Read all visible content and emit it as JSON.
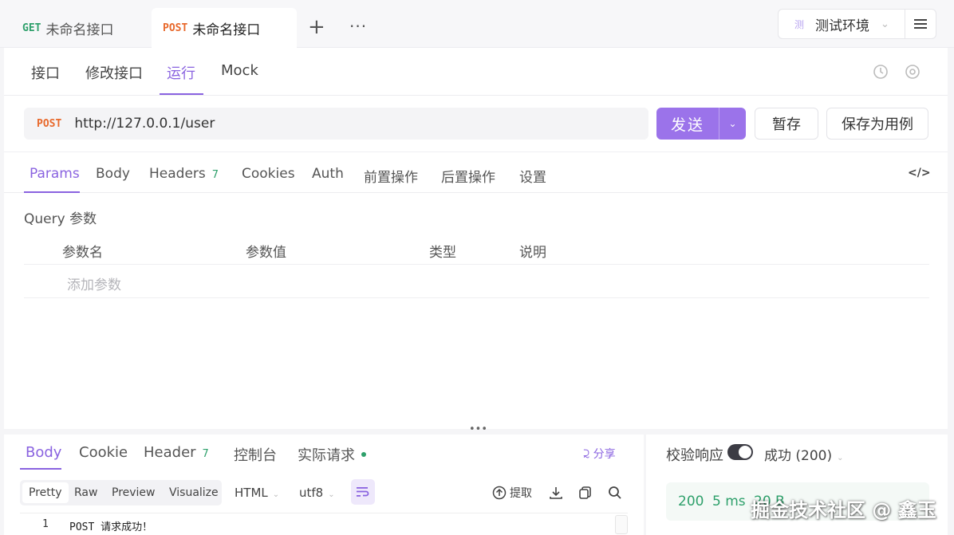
{
  "tabs": [
    {
      "method": "GET",
      "label": "未命名接口"
    },
    {
      "method": "POST",
      "label": "未命名接口"
    }
  ],
  "toolbar": {
    "plus": "+",
    "more": "···"
  },
  "environment": {
    "icon_char": "测",
    "label": "测试环境"
  },
  "subnav": [
    "接口",
    "修改接口",
    "运行",
    "Mock"
  ],
  "request": {
    "method": "POST",
    "url": "http://127.0.0.1/user",
    "send_label": "发送",
    "save_label": "暂存",
    "save_case_label": "保存为用例"
  },
  "param_tabs": {
    "params": "Params",
    "body": "Body",
    "headers": "Headers",
    "headers_count": "7",
    "cookies": "Cookies",
    "auth": "Auth",
    "pre": "前置操作",
    "post": "后置操作",
    "settings": "设置"
  },
  "query": {
    "title": "Query 参数",
    "columns": [
      "参数名",
      "参数值",
      "类型",
      "说明"
    ],
    "add_placeholder": "添加参数"
  },
  "response": {
    "tabs": {
      "body": "Body",
      "cookie": "Cookie",
      "header": "Header",
      "header_count": "7",
      "console": "控制台",
      "actual": "实际请求"
    },
    "share": "分享",
    "formats": [
      "Pretty",
      "Raw",
      "Preview",
      "Visualize"
    ],
    "content_type": "HTML",
    "encoding": "utf8",
    "extract": "提取",
    "line_number": "1",
    "code": "POST 请求成功！"
  },
  "validation": {
    "label": "校验响应",
    "enabled": true,
    "status": "成功 (200)",
    "code": "200",
    "time": "5 ms",
    "size": "20 B"
  },
  "watermark": "掘金技术社区 @ 鑫玉",
  "colors": {
    "accent": "#9b73ea",
    "get": "#2ea06b",
    "post": "#e8692c",
    "success": "#2ea06b"
  }
}
